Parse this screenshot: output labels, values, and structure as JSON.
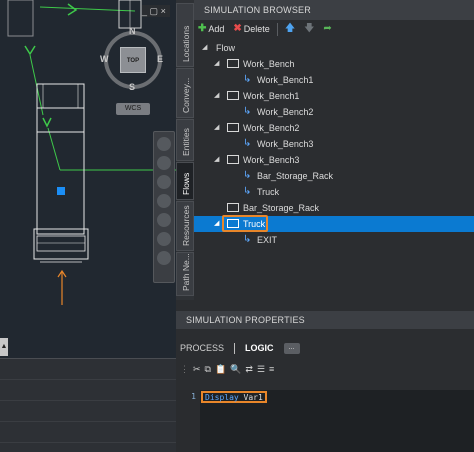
{
  "viewport": {
    "viewcube": {
      "top_face": "TOP",
      "north": "N",
      "south": "S",
      "east": "E",
      "west": "W"
    },
    "wcs_label": "WCS",
    "window_controls": [
      "_",
      "▢",
      "×"
    ]
  },
  "vertical_tabs": [
    {
      "label": "Locations",
      "active": false
    },
    {
      "label": "Convey...",
      "active": false
    },
    {
      "label": "Entities",
      "active": false
    },
    {
      "label": "Flows",
      "active": true
    },
    {
      "label": "Resources",
      "active": false
    },
    {
      "label": "Path Ne...",
      "active": false
    }
  ],
  "browser": {
    "title": "SIMULATION BROWSER",
    "toolbar": {
      "add_label": "Add",
      "delete_label": "Delete",
      "add_icon": "plus-icon",
      "delete_icon": "x-icon",
      "move_up_icon": "arrow-up-icon",
      "move_down_icon": "arrow-down-icon",
      "go_icon": "arrow-right-icon"
    },
    "tree": [
      {
        "label": "Flow",
        "level": 0,
        "type": "folder",
        "expanded": true
      },
      {
        "label": "Work_Bench",
        "level": 1,
        "type": "location",
        "expanded": true
      },
      {
        "label": "Work_Bench1",
        "level": 2,
        "type": "link"
      },
      {
        "label": "Work_Bench1",
        "level": 1,
        "type": "location",
        "expanded": true
      },
      {
        "label": "Work_Bench2",
        "level": 2,
        "type": "link"
      },
      {
        "label": "Work_Bench2",
        "level": 1,
        "type": "location",
        "expanded": true
      },
      {
        "label": "Work_Bench3",
        "level": 2,
        "type": "link"
      },
      {
        "label": "Work_Bench3",
        "level": 1,
        "type": "location",
        "expanded": true
      },
      {
        "label": "Bar_Storage_Rack",
        "level": 2,
        "type": "link"
      },
      {
        "label": "Truck",
        "level": 2,
        "type": "link"
      },
      {
        "label": "Bar_Storage_Rack",
        "level": 1,
        "type": "location",
        "expanded": false
      },
      {
        "label": "Truck",
        "level": 1,
        "type": "location",
        "expanded": true,
        "selected": true,
        "highlighted": true
      },
      {
        "label": "EXIT",
        "level": 2,
        "type": "link"
      }
    ]
  },
  "properties": {
    "title": "SIMULATION PROPERTIES",
    "tabs": [
      {
        "label": "PROCESS",
        "active": false
      },
      {
        "label": "LOGIC",
        "active": true
      }
    ],
    "more_label": "...",
    "editor": {
      "line_number": "1",
      "keyword": "Display",
      "argument": "Var1"
    }
  },
  "colors": {
    "selection": "#0b7ad1",
    "highlight": "#e8862a",
    "keyword": "#5ea9ff"
  }
}
